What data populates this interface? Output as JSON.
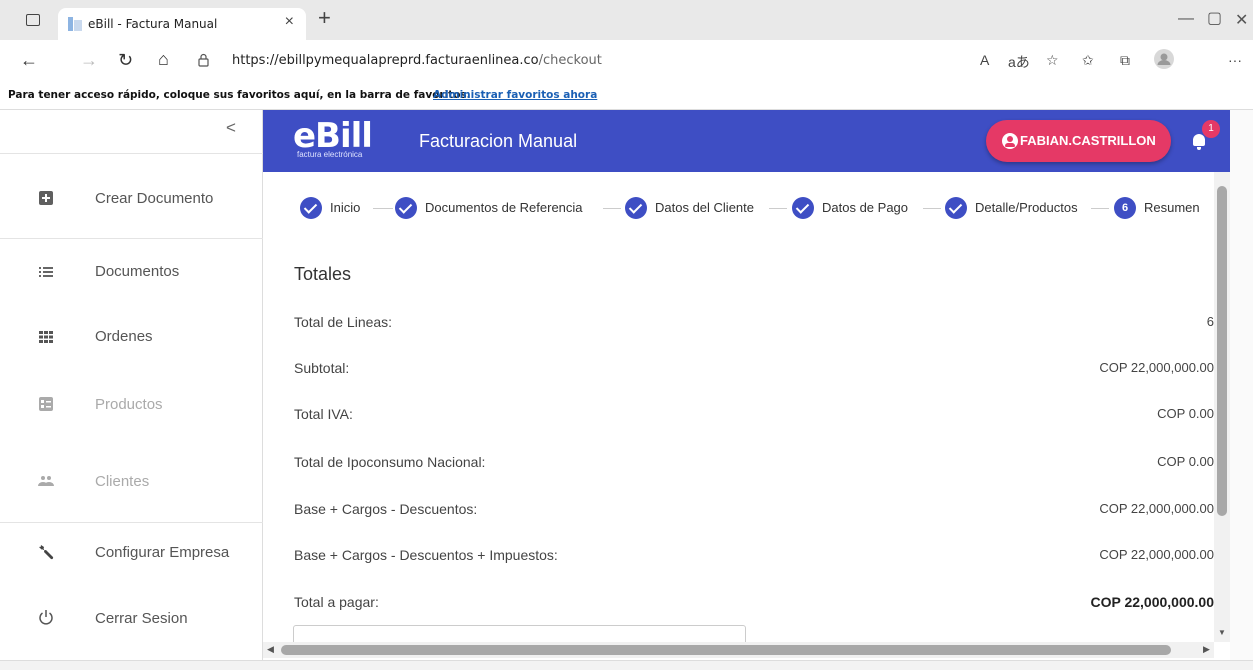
{
  "browser": {
    "tab_title": "eBill - Factura Manual",
    "tab_close": "×",
    "new_tab": "+",
    "url_host": "https://ebillpymequalapreprd.facturaenlinea.co",
    "url_path": "/checkout",
    "favorites_message": "Para tener acceso rápido, coloque sus favoritos aquí, en la barra de favoritos.",
    "favorites_link": "Administrar favoritos ahora"
  },
  "sidebar": {
    "collapse": "<",
    "items": [
      {
        "label": "Crear Documento",
        "icon": "add-box-icon"
      },
      {
        "label": "Documentos",
        "icon": "list-icon"
      },
      {
        "label": "Ordenes",
        "icon": "grid-icon"
      },
      {
        "label": "Productos",
        "icon": "product-icon"
      },
      {
        "label": "Clientes",
        "icon": "people-icon"
      },
      {
        "label": "Configurar Empresa",
        "icon": "wrench-icon"
      },
      {
        "label": "Cerrar Sesion",
        "icon": "power-icon"
      }
    ]
  },
  "header": {
    "logo_text": "eBill",
    "logo_sub": "factura electrónica",
    "title": "Facturacion Manual",
    "user": "FABIAN.CASTRILLON",
    "notifications": "1",
    "brand_color": "#3e4ec4",
    "accent_color": "#e53966"
  },
  "stepper": {
    "steps": [
      {
        "label": "Inicio",
        "state": "done"
      },
      {
        "label": "Documentos de Referencia",
        "state": "done"
      },
      {
        "label": "Datos del Cliente",
        "state": "done"
      },
      {
        "label": "Datos de Pago",
        "state": "done"
      },
      {
        "label": "Detalle/Productos",
        "state": "done"
      },
      {
        "label": "Resumen",
        "state": "active",
        "number": "6"
      }
    ]
  },
  "totales": {
    "title": "Totales",
    "rows": [
      {
        "label": "Total de Lineas:",
        "value": "6"
      },
      {
        "label": "Subtotal:",
        "value": "COP 22,000,000.00"
      },
      {
        "label": "Total IVA:",
        "value": "COP 0.00"
      },
      {
        "label": "Total de Ipoconsumo Nacional:",
        "value": "COP 0.00"
      },
      {
        "label": "Base + Cargos - Descuentos:",
        "value": "COP 22,000,000.00"
      },
      {
        "label": "Base + Cargos - Descuentos + Impuestos:",
        "value": "COP 22,000,000.00"
      },
      {
        "label": "Total a pagar:",
        "value": "COP 22,000,000.00"
      }
    ]
  }
}
